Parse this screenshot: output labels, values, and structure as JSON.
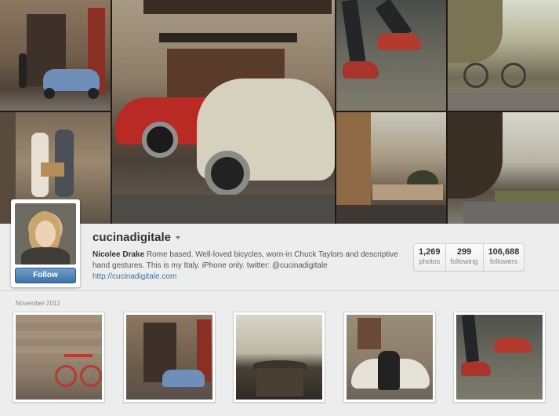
{
  "profile": {
    "username": "cucinadigitale",
    "follow_label": "Follow",
    "full_name": "Nicolee Drake",
    "bio": "Rome based. Well-loved bicycles, worn-in Chuck Taylors and descriptive hand gestures. This is my Italy. iPhone only. twitter: @cucinadigitale",
    "website": "http://cucinadigitale.com"
  },
  "stats": [
    {
      "value": "1,269",
      "label": "photos"
    },
    {
      "value": "299",
      "label": "following"
    },
    {
      "value": "106,688",
      "label": "followers"
    }
  ],
  "feed": {
    "month_label": "November 2012"
  },
  "colors": {
    "follow_button": "#3e73a8",
    "link": "#3f729b",
    "background": "#ededed"
  },
  "icons": {
    "username_menu": "chevron-down-icon"
  }
}
